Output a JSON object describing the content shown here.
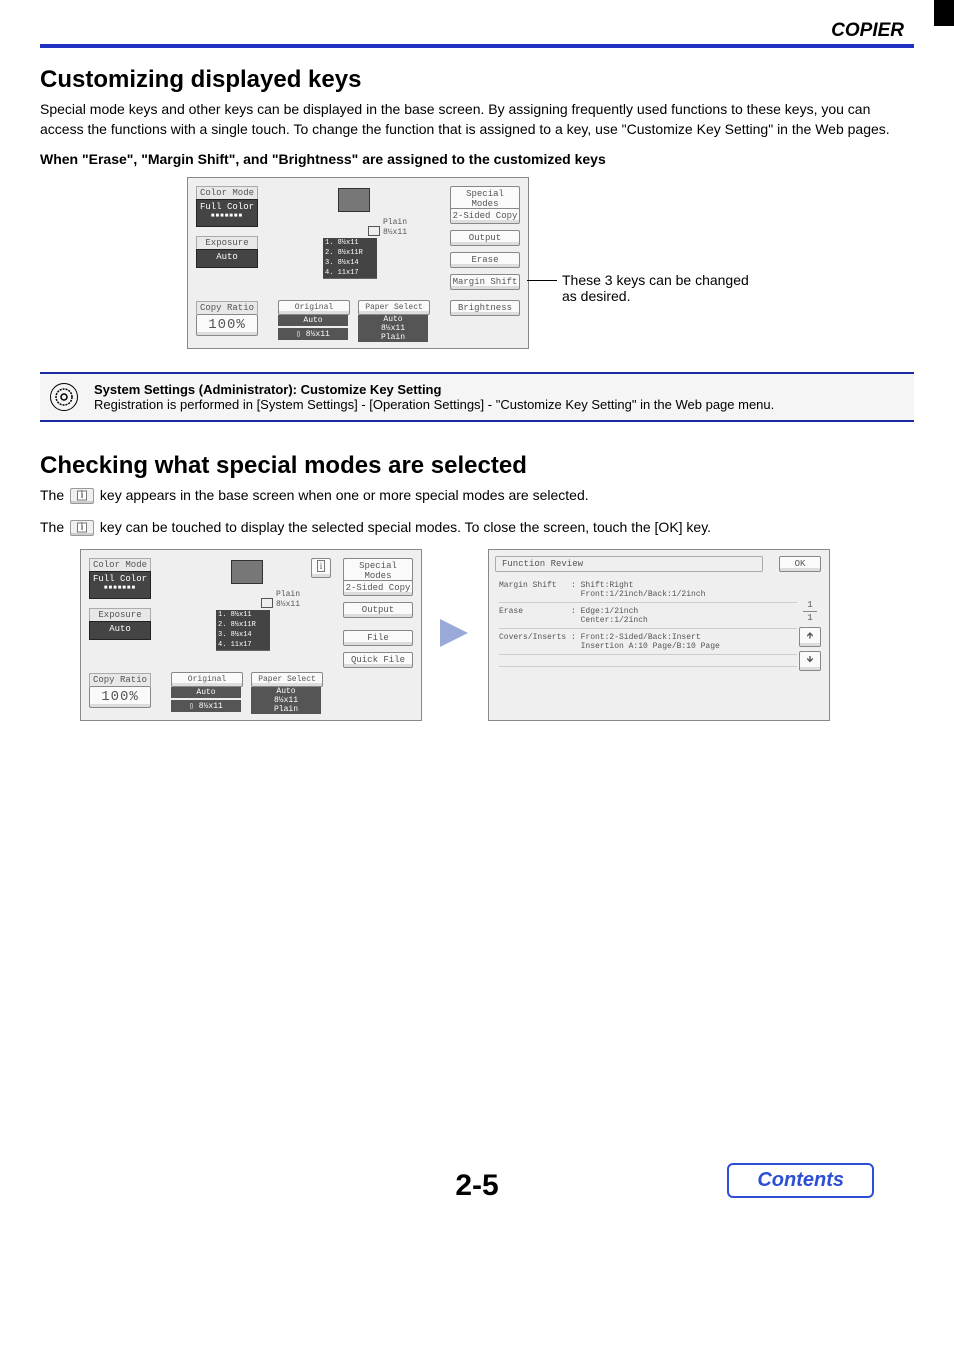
{
  "header": {
    "section": "COPIER"
  },
  "section1": {
    "title": "Customizing displayed keys",
    "para": "Special mode keys and other keys can be displayed in the base screen. By assigning frequently used functions to these keys, you can access the functions with a single touch. To change the function that is assigned to a key, use \"Customize Key Setting\" in the Web pages.",
    "subhead": "When \"Erase\", \"Margin Shift\", and \"Brightness\" are assigned to the customized keys",
    "callout": "These 3 keys can be changed as desired.",
    "panel": {
      "left": {
        "color_mode": "Color Mode",
        "full_color": "Full Color",
        "exposure": "Exposure",
        "auto": "Auto",
        "copy_ratio": "Copy Ratio",
        "percent": "100%"
      },
      "center": {
        "plain": "Plain",
        "paper": "8½x11",
        "tray1": "1. 8½x11",
        "tray2": "2. 8½x11R",
        "tray3": "3. 8½x14",
        "tray4": "4. 11x17",
        "original_title": "Original",
        "original_auto": "Auto",
        "original_paper": "8½x11",
        "paper_select_title": "Paper Select",
        "paper_auto": "Auto",
        "paper_size": "8½x11",
        "paper_plain": "Plain"
      },
      "right": {
        "special": "Special Modes",
        "twosided": "2-Sided Copy",
        "output": "Output",
        "erase": "Erase",
        "margin": "Margin Shift",
        "brightness": "Brightness"
      }
    }
  },
  "note": {
    "title": "System Settings (Administrator): Customize Key Setting",
    "body": "Registration is performed in [System Settings] - [Operation Settings] - \"Customize Key Setting\" in the Web page menu."
  },
  "section2": {
    "title": "Checking what special modes are selected",
    "line1a": "The ",
    "line1b": " key appears in the base screen when one or more special modes are selected.",
    "line2a": "The ",
    "line2b": " key can be touched to display the selected special modes. To close the screen, touch the [OK] key.",
    "panelA": {
      "right": {
        "special": "Special Modes",
        "twosided": "2-Sided Copy",
        "output": "Output",
        "file": "File",
        "quickfile": "Quick File"
      }
    },
    "panelB": {
      "header": "Function Review",
      "ok": "OK",
      "rows": [
        {
          "label": "Margin Shift",
          "l1": "Shift:Right",
          "l2": "Front:1/2inch/Back:1/2inch"
        },
        {
          "label": "Erase",
          "l1": "Edge:1/2inch",
          "l2": "Center:1/2inch"
        },
        {
          "label": "Covers/Inserts",
          "l1": "Front:2-Sided/Back:Insert",
          "l2": "Insertion A:10 Page/B:10 Page"
        }
      ],
      "pager": {
        "current": "1",
        "total": "1"
      }
    }
  },
  "footer": {
    "pagenum": "2-5",
    "contents": "Contents"
  }
}
